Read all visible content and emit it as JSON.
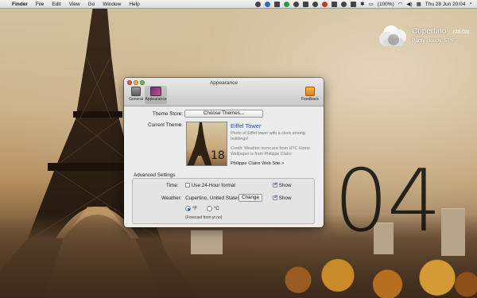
{
  "menubar": {
    "apple_icon": "apple-logo",
    "app_name": "Finder",
    "menus": [
      "File",
      "Edit",
      "View",
      "Go",
      "Window",
      "Help"
    ],
    "battery": "(100%)",
    "clock": "Thu 28 Jun  20:04"
  },
  "weather": {
    "city": "Cupertino",
    "time": "(20:03)",
    "condition": "Partly cloudy, 57°F"
  },
  "bigclock": {
    "minutes": "04"
  },
  "window": {
    "title": "Appearance",
    "toolbar": {
      "general_label": "General",
      "appearance_label": "Appearance",
      "feedback_label": "Feedback"
    },
    "theme_store_label": "Theme Store:",
    "choose_themes_button": "Choose Themes...",
    "current_theme_label": "Current Theme:",
    "theme": {
      "name": "Eiffel Tower",
      "description": "Photo of Eiffel tower with a clock among buildings!",
      "credit": "Credit: Weather icons are from HTC Home. Wallpaper is from Philippe Clairo",
      "link": "Philippe Clairo Web Site >"
    },
    "advanced_title": "Advanced Settings",
    "time_label": "Time:",
    "use24_label": "Use 24-Hour format",
    "time_show_label": "Show",
    "weather_label": "Weather:",
    "weather_location": "Cupertino, United States",
    "change_button": "Change",
    "weather_show_label": "Show",
    "unit_f": "°F",
    "unit_c": "°C",
    "forecast_note": "(Forecast from yr.no)"
  }
}
